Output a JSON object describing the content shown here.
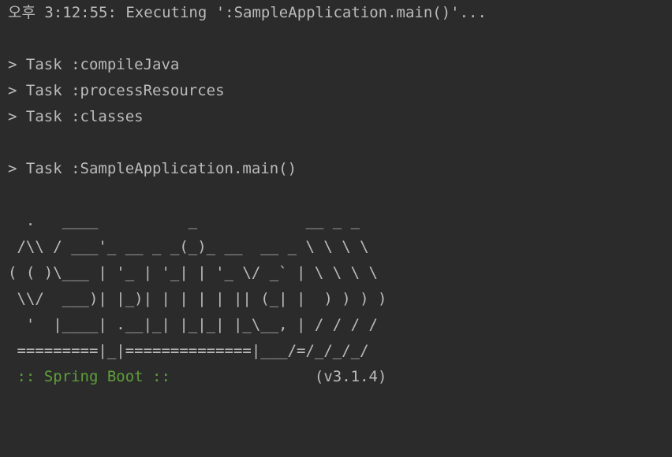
{
  "console": {
    "exec_line": "오후 3:12:55: Executing ':SampleApplication.main()'...",
    "tasks": [
      "> Task :compileJava",
      "> Task :processResources",
      "> Task :classes"
    ],
    "main_task": "> Task :SampleApplication.main()",
    "banner": [
      "  .   ____          _            __ _ _",
      " /\\\\ / ___'_ __ _ _(_)_ __  __ _ \\ \\ \\ \\",
      "( ( )\\___ | '_ | '_| | '_ \\/ _` | \\ \\ \\ \\",
      " \\\\/  ___)| |_)| | | | | || (_| |  ) ) ) )",
      "  '  |____| .__|_| |_|_| |_\\__, | / / / /",
      " =========|_|==============|___/=/_/_/_/"
    ],
    "spring_label": " :: Spring Boot :: ",
    "spring_version": "               (v3.1.4)"
  },
  "colors": {
    "background": "#2b2b2b",
    "text": "#bbbbbb",
    "spring_green": "#5f9f3b"
  }
}
